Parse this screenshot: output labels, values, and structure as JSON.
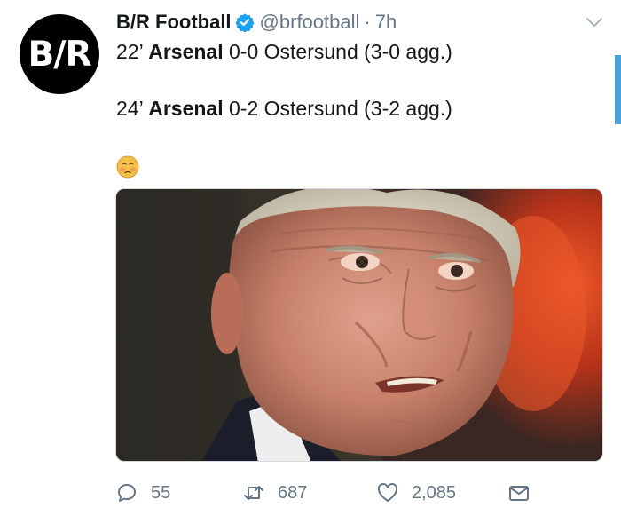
{
  "tweet": {
    "avatar_text": "B/R",
    "display_name": "B/R Football",
    "handle": "@brfootball",
    "separator": "·",
    "time": "7h",
    "lines": [
      {
        "prefix": "22’ ",
        "bold": "Arsenal",
        "suffix": " 0-0 Ostersund (3-0 agg.)"
      },
      {
        "prefix": "24’ ",
        "bold": "Arsenal",
        "suffix": " 0-2 Ostersund (3-2 agg.)"
      }
    ],
    "emoji": "disappointed-face-emoji",
    "media_description": "photo"
  },
  "actions": {
    "reply_count": "55",
    "retweet_count": "687",
    "like_count": "2,085"
  },
  "colors": {
    "text": "#14171a",
    "muted": "#657786",
    "verified": "#1da1f2",
    "accent": "#4aa3df"
  },
  "icons": [
    "reply-icon",
    "retweet-icon",
    "like-icon",
    "direct-message-icon",
    "verified-badge-icon",
    "chevron-down-icon"
  ]
}
